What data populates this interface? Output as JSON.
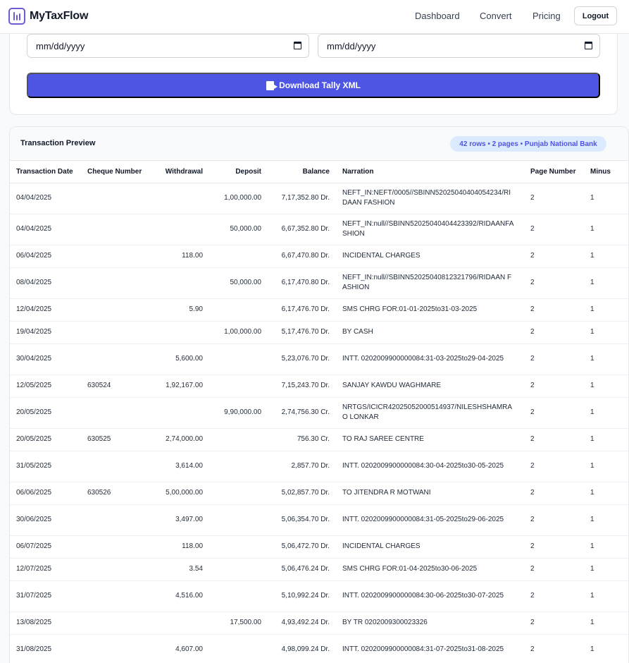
{
  "brand": {
    "name": "MyTaxFlow"
  },
  "nav": {
    "dashboard": "Dashboard",
    "convert": "Convert",
    "pricing": "Pricing",
    "logout": "Logout"
  },
  "export": {
    "from_date": "mm/dd/yyyy",
    "to_date": "mm/dd/yyyy",
    "download_label": "Download Tally XML"
  },
  "preview": {
    "title": "Transaction Preview",
    "badge": "42 rows • 2 pages • Punjab National Bank",
    "columns": [
      "Transaction Date",
      "Cheque Number",
      "Withdrawal",
      "Deposit",
      "Balance",
      "Narration",
      "Page Number",
      "Minus"
    ],
    "rows": [
      {
        "date": "04/04/2025",
        "cheque": "",
        "withdrawal": "",
        "deposit": "1,00,000.00",
        "balance": "7,17,352.80 Dr.",
        "narration": "NEFT_IN:NEFT/0005//SBINN52025040404054234/RIDAAN FASHION",
        "page": "2",
        "minus": "1"
      },
      {
        "date": "04/04/2025",
        "cheque": "",
        "withdrawal": "",
        "deposit": "50,000.00",
        "balance": "6,67,352.80 Dr.",
        "narration": "NEFT_IN:null//SBINN52025040404423392/RIDAANFASHION",
        "page": "2",
        "minus": "1"
      },
      {
        "date": "06/04/2025",
        "cheque": "",
        "withdrawal": "118.00",
        "deposit": "",
        "balance": "6,67,470.80 Dr.",
        "narration": "INCIDENTAL CHARGES",
        "page": "2",
        "minus": "1"
      },
      {
        "date": "08/04/2025",
        "cheque": "",
        "withdrawal": "",
        "deposit": "50,000.00",
        "balance": "6,17,470.80 Dr.",
        "narration": "NEFT_IN:null//SBINN52025040812321796/RIDAAN FASHION",
        "page": "2",
        "minus": "1"
      },
      {
        "date": "12/04/2025",
        "cheque": "",
        "withdrawal": "5.90",
        "deposit": "",
        "balance": "6,17,476.70 Dr.",
        "narration": "SMS CHRG FOR:01-01-2025to31-03-2025",
        "page": "2",
        "minus": "1"
      },
      {
        "date": "19/04/2025",
        "cheque": "",
        "withdrawal": "",
        "deposit": "1,00,000.00",
        "balance": "5,17,476.70 Dr.",
        "narration": "BY CASH",
        "page": "2",
        "minus": "1"
      },
      {
        "date": "30/04/2025",
        "cheque": "",
        "withdrawal": "5,600.00",
        "deposit": "",
        "balance": "5,23,076.70 Dr.",
        "narration": "INTT. 0202009900000084:31-03-2025to29-04-2025",
        "page": "2",
        "minus": "1"
      },
      {
        "date": "12/05/2025",
        "cheque": "630524",
        "withdrawal": "1,92,167.00",
        "deposit": "",
        "balance": "7,15,243.70 Dr.",
        "narration": "SANJAY KAWDU WAGHMARE",
        "page": "2",
        "minus": "1"
      },
      {
        "date": "20/05/2025",
        "cheque": "",
        "withdrawal": "",
        "deposit": "9,90,000.00",
        "balance": "2,74,756.30 Cr.",
        "narration": "NRTGS/ICICR42025052000514937/NILESHSHAMRAO LONKAR",
        "page": "2",
        "minus": "1"
      },
      {
        "date": "20/05/2025",
        "cheque": "630525",
        "withdrawal": "2,74,000.00",
        "deposit": "",
        "balance": "756.30 Cr.",
        "narration": "TO RAJ SAREE CENTRE",
        "page": "2",
        "minus": "1"
      },
      {
        "date": "31/05/2025",
        "cheque": "",
        "withdrawal": "3,614.00",
        "deposit": "",
        "balance": "2,857.70 Dr.",
        "narration": "INTT. 0202009900000084:30-04-2025to30-05-2025",
        "page": "2",
        "minus": "1"
      },
      {
        "date": "06/06/2025",
        "cheque": "630526",
        "withdrawal": "5,00,000.00",
        "deposit": "",
        "balance": "5,02,857.70 Dr.",
        "narration": "TO JITENDRA R MOTWANI",
        "page": "2",
        "minus": "1"
      },
      {
        "date": "30/06/2025",
        "cheque": "",
        "withdrawal": "3,497.00",
        "deposit": "",
        "balance": "5,06,354.70 Dr.",
        "narration": "INTT. 0202009900000084:31-05-2025to29-06-2025",
        "page": "2",
        "minus": "1"
      },
      {
        "date": "06/07/2025",
        "cheque": "",
        "withdrawal": "118.00",
        "deposit": "",
        "balance": "5,06,472.70 Dr.",
        "narration": "INCIDENTAL CHARGES",
        "page": "2",
        "minus": "1"
      },
      {
        "date": "12/07/2025",
        "cheque": "",
        "withdrawal": "3.54",
        "deposit": "",
        "balance": "5,06,476.24 Dr.",
        "narration": "SMS CHRG FOR:01-04-2025to30-06-2025",
        "page": "2",
        "minus": "1"
      },
      {
        "date": "31/07/2025",
        "cheque": "",
        "withdrawal": "4,516.00",
        "deposit": "",
        "balance": "5,10,992.24 Dr.",
        "narration": "INTT. 0202009900000084:30-06-2025to30-07-2025",
        "page": "2",
        "minus": "1"
      },
      {
        "date": "13/08/2025",
        "cheque": "",
        "withdrawal": "",
        "deposit": "17,500.00",
        "balance": "4,93,492.24 Dr.",
        "narration": "BY TR 0202009300023326",
        "page": "2",
        "minus": "1"
      },
      {
        "date": "31/08/2025",
        "cheque": "",
        "withdrawal": "4,607.00",
        "deposit": "",
        "balance": "4,98,099.24 Dr.",
        "narration": "INTT. 0202009900000084:31-07-2025to31-08-2025",
        "page": "2",
        "minus": "1"
      }
    ]
  }
}
